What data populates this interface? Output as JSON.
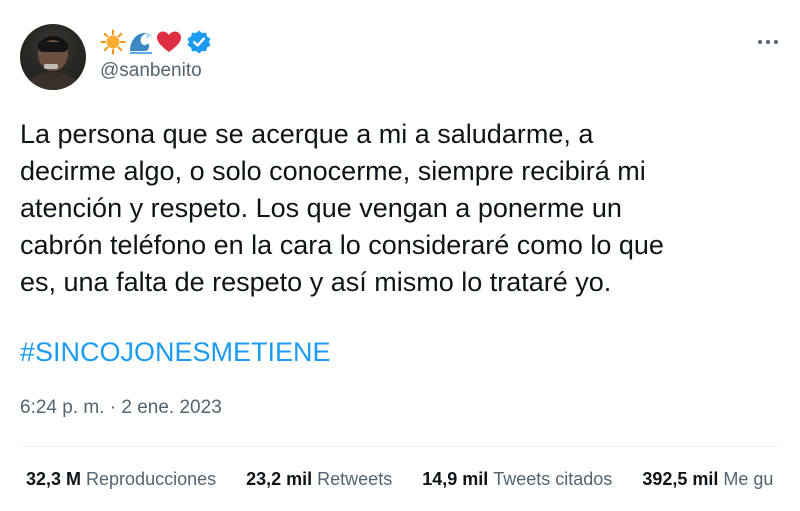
{
  "author": {
    "display_name_emojis": [
      "sun-emoji",
      "water-wave-emoji",
      "red-heart-emoji"
    ],
    "verified": true,
    "handle": "@sanbenito"
  },
  "tweet": {
    "text_lines": [
      "La persona que se acerque a mi a saludarme, a",
      "decirme algo, o solo conocerme, siempre recibirá mi",
      "atención y respeto. Los que vengan a ponerme un",
      "cabrón teléfono en la cara lo consideraré como lo que",
      "es, una falta de respeto y así mismo lo trataré yo."
    ],
    "hashtag": "#SINCOJONESMETIENE",
    "time": "6:24 p. m.",
    "separator": "·",
    "date": "2 ene. 2023"
  },
  "stats": [
    {
      "value": "32,3 M",
      "label": "Reproducciones"
    },
    {
      "value": "23,2 mil",
      "label": "Retweets"
    },
    {
      "value": "14,9 mil",
      "label": "Tweets citados"
    },
    {
      "value": "392,5 mil",
      "label": "Me gu"
    }
  ],
  "icons": {
    "more": "more-horizontal-icon",
    "verified": "verified-badge-icon"
  },
  "colors": {
    "text": "#0f1419",
    "secondary": "#536471",
    "link": "#1d9bf0",
    "verified": "#1d9bf0",
    "divider": "#eff3f4"
  }
}
